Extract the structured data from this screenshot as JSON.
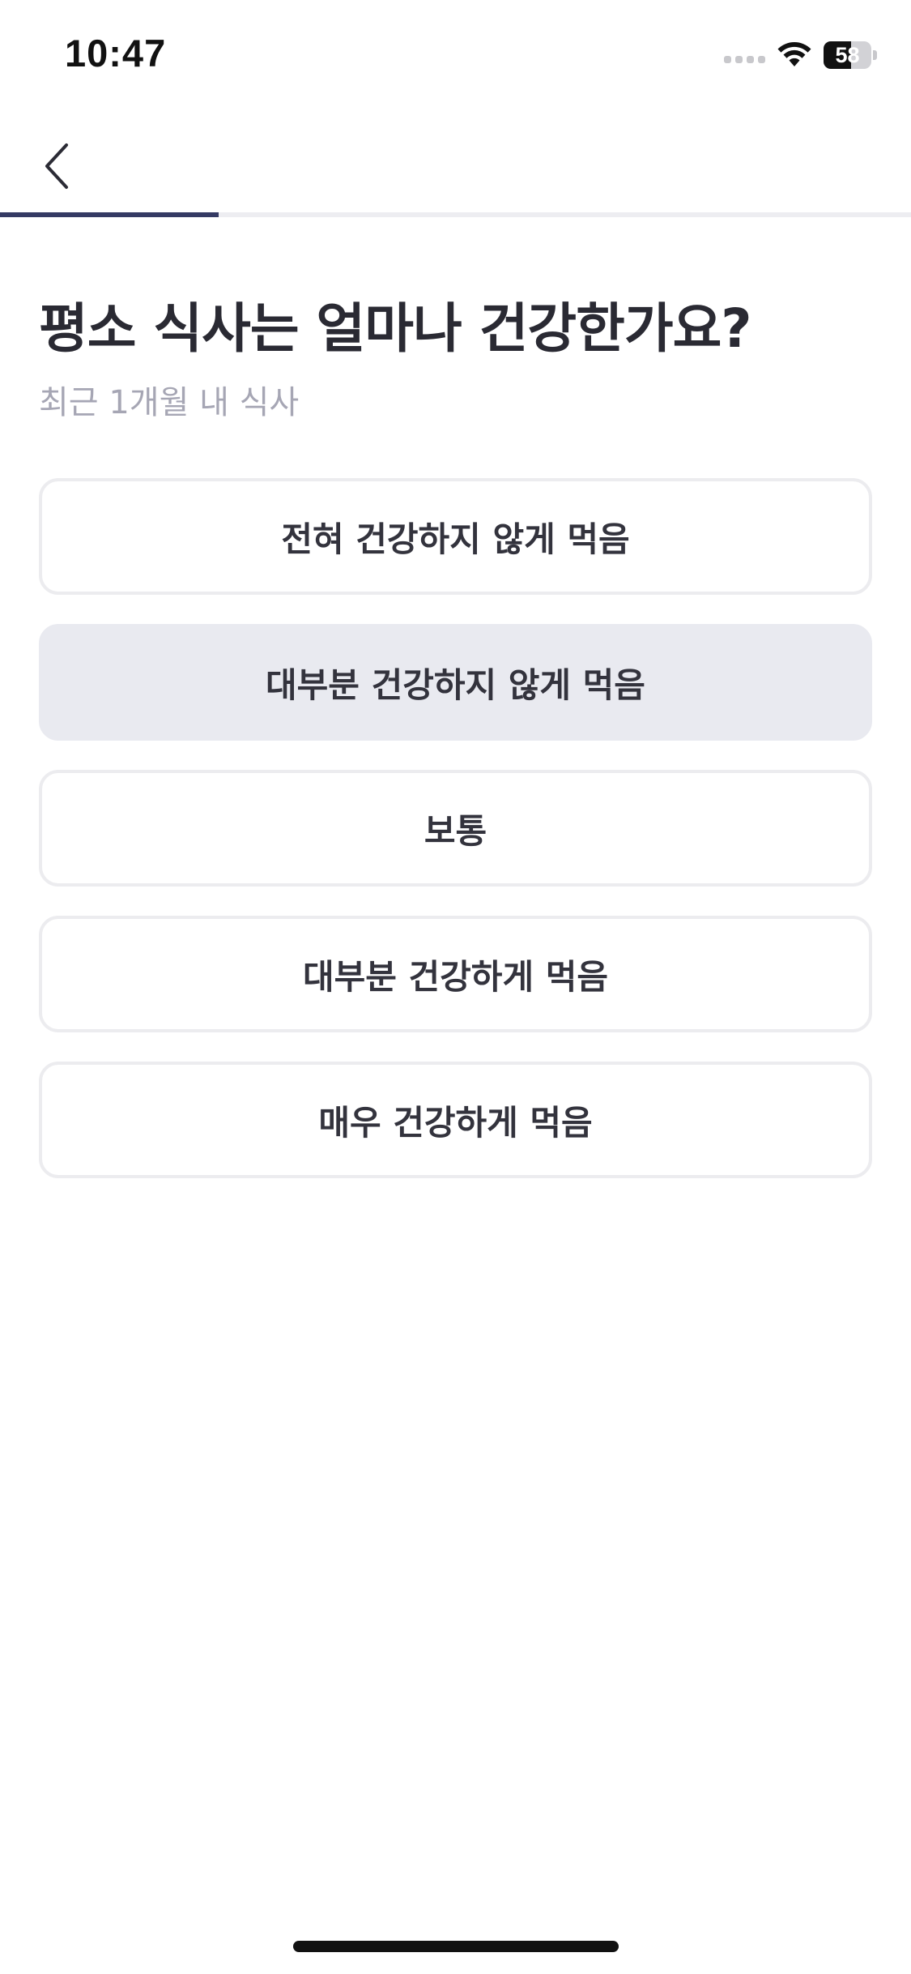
{
  "status_bar": {
    "time": "10:47",
    "battery_percent": "58",
    "battery_level": 0.58,
    "icons": [
      "cellular-signal-icon",
      "wifi-icon",
      "battery-icon"
    ]
  },
  "nav": {
    "back_icon": "chevron-left-icon"
  },
  "progress": {
    "fraction": 0.24,
    "color": "#343a63",
    "track_color": "#ededf1"
  },
  "question": {
    "title": "평소 식사는 얼마나 건강한가요?",
    "subtitle": "최근 1개월 내 식사"
  },
  "options": [
    {
      "label": "전혀 건강하지 않게 먹음",
      "selected": false
    },
    {
      "label": "대부분 건강하지 않게 먹음",
      "selected": true
    },
    {
      "label": "보통",
      "selected": false
    },
    {
      "label": "대부분 건강하게 먹음",
      "selected": false
    },
    {
      "label": "매우 건강하게 먹음",
      "selected": false
    }
  ],
  "colors": {
    "selected_option_bg": "#e9eaf0",
    "option_border": "#ececef",
    "title_text": "#2a2a33",
    "subtitle_text": "#a6a6b4"
  }
}
